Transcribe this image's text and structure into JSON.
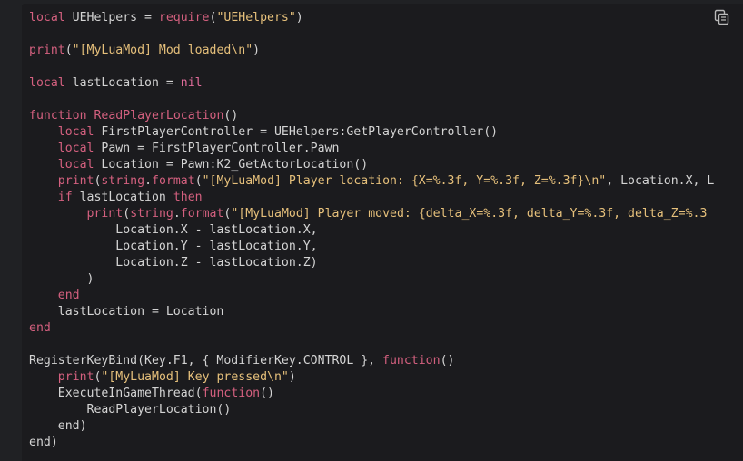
{
  "code_block": {
    "copy_icon": "copy-icon",
    "lines": [
      [
        [
          "kw",
          "local"
        ],
        [
          "plain",
          " UEHelpers = "
        ],
        [
          "kw",
          "require"
        ],
        [
          "plain",
          "("
        ],
        [
          "str",
          "\"UEHelpers\""
        ],
        [
          "plain",
          ")"
        ]
      ],
      [],
      [
        [
          "kw",
          "print"
        ],
        [
          "plain",
          "("
        ],
        [
          "str",
          "\"[MyLuaMod] Mod loaded\\n\""
        ],
        [
          "plain",
          ")"
        ]
      ],
      [],
      [
        [
          "kw",
          "local"
        ],
        [
          "plain",
          " lastLocation = "
        ],
        [
          "nil",
          "nil"
        ]
      ],
      [],
      [
        [
          "kw",
          "function"
        ],
        [
          "plain",
          " "
        ],
        [
          "fn",
          "ReadPlayerLocation"
        ],
        [
          "plain",
          "()"
        ]
      ],
      [
        [
          "plain",
          "    "
        ],
        [
          "kw",
          "local"
        ],
        [
          "plain",
          " FirstPlayerController = UEHelpers:GetPlayerController()"
        ]
      ],
      [
        [
          "plain",
          "    "
        ],
        [
          "kw",
          "local"
        ],
        [
          "plain",
          " Pawn = FirstPlayerController.Pawn"
        ]
      ],
      [
        [
          "plain",
          "    "
        ],
        [
          "kw",
          "local"
        ],
        [
          "plain",
          " Location = Pawn:K2_GetActorLocation()"
        ]
      ],
      [
        [
          "plain",
          "    "
        ],
        [
          "kw",
          "print"
        ],
        [
          "plain",
          "("
        ],
        [
          "kw",
          "string"
        ],
        [
          "plain",
          "."
        ],
        [
          "kw",
          "format"
        ],
        [
          "plain",
          "("
        ],
        [
          "str",
          "\"[MyLuaMod] Player location: {X=%.3f, Y=%.3f, Z=%.3f}\\n\""
        ],
        [
          "plain",
          ", Location.X, L"
        ]
      ],
      [
        [
          "plain",
          "    "
        ],
        [
          "kw",
          "if"
        ],
        [
          "plain",
          " lastLocation "
        ],
        [
          "kw",
          "then"
        ]
      ],
      [
        [
          "plain",
          "        "
        ],
        [
          "kw",
          "print"
        ],
        [
          "plain",
          "("
        ],
        [
          "kw",
          "string"
        ],
        [
          "plain",
          "."
        ],
        [
          "kw",
          "format"
        ],
        [
          "plain",
          "("
        ],
        [
          "str",
          "\"[MyLuaMod] Player moved: {delta_X=%.3f, delta_Y=%.3f, delta_Z=%.3"
        ]
      ],
      [
        [
          "plain",
          "            Location.X - lastLocation.X,"
        ]
      ],
      [
        [
          "plain",
          "            Location.Y - lastLocation.Y,"
        ]
      ],
      [
        [
          "plain",
          "            Location.Z - lastLocation.Z)"
        ]
      ],
      [
        [
          "plain",
          "        )"
        ]
      ],
      [
        [
          "plain",
          "    "
        ],
        [
          "kw",
          "end"
        ]
      ],
      [
        [
          "plain",
          "    lastLocation = Location"
        ]
      ],
      [
        [
          "kw",
          "end"
        ]
      ],
      [],
      [
        [
          "plain",
          "RegisterKeyBind(Key.F1, { ModifierKey.CONTROL }, "
        ],
        [
          "kw",
          "function"
        ],
        [
          "plain",
          "()"
        ]
      ],
      [
        [
          "plain",
          "    "
        ],
        [
          "kw",
          "print"
        ],
        [
          "plain",
          "("
        ],
        [
          "str",
          "\"[MyLuaMod] Key pressed\\n\""
        ],
        [
          "plain",
          ")"
        ]
      ],
      [
        [
          "plain",
          "    ExecuteInGameThread("
        ],
        [
          "kw",
          "function"
        ],
        [
          "plain",
          "()"
        ]
      ],
      [
        [
          "plain",
          "        ReadPlayerLocation()"
        ]
      ],
      [
        [
          "plain",
          "    end)"
        ]
      ],
      [
        [
          "plain",
          "end)"
        ]
      ]
    ]
  }
}
